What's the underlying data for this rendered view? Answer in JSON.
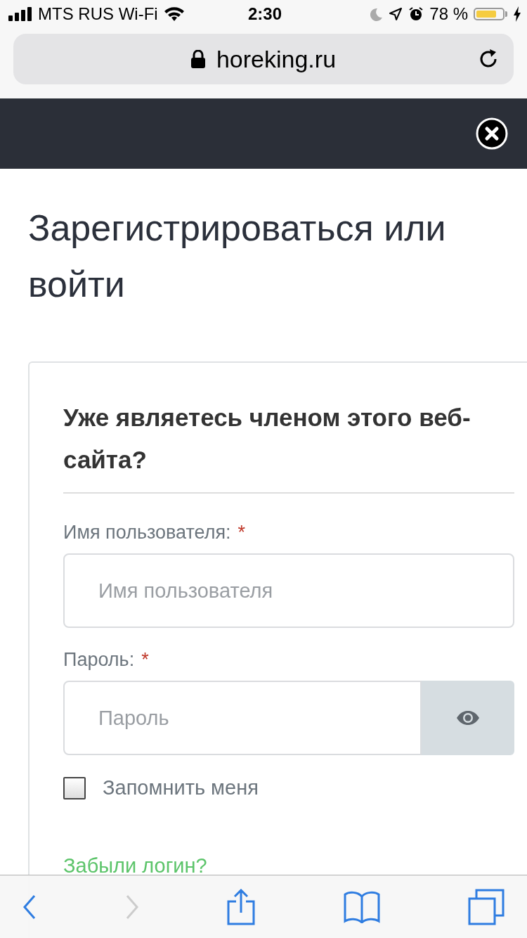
{
  "status_bar": {
    "carrier": "MTS RUS Wi-Fi",
    "time": "2:30",
    "battery_percent": "78 %",
    "battery": {
      "level": 0.78
    }
  },
  "address_bar": {
    "url": "horeking.ru",
    "secure": true
  },
  "page": {
    "title": "Зарегистрироваться или войти",
    "login_card": {
      "heading": "Уже являетесь членом этого веб-сайта?",
      "fields": [
        {
          "kind": "text",
          "label": "Имя пользователя:",
          "required_mark": "*",
          "placeholder": "Имя пользователя"
        },
        {
          "kind": "password",
          "label": "Пароль:",
          "required_mark": "*",
          "placeholder": "Пароль"
        }
      ],
      "remember": {
        "label": "Запомнить меня",
        "checked": false
      },
      "forgot_link": "Забыли логин?"
    }
  },
  "toolbar": [
    {
      "kind": "back",
      "disabled": false
    },
    {
      "kind": "forward",
      "disabled": true
    },
    {
      "kind": "share",
      "disabled": false
    },
    {
      "kind": "bookmarks",
      "disabled": false
    },
    {
      "kind": "tabs",
      "disabled": false
    }
  ]
}
